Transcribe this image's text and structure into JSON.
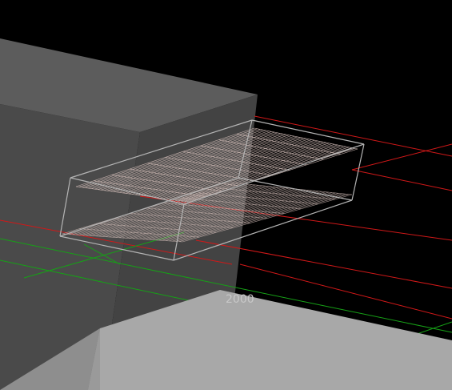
{
  "scene": {
    "axis_label": "2000",
    "colors": {
      "background": "#000000",
      "block_front": "#4a4a4a",
      "block_top": "#5c5c5c",
      "block_right_edge": "#404040",
      "lower_block_top": "#a8a8a8",
      "lower_block_front": "#8e8e8e",
      "wireframe": "#b4b4b4",
      "mesh": "#c9b5b0",
      "red_grid": "#d01818",
      "green_grid": "#16a016"
    }
  }
}
